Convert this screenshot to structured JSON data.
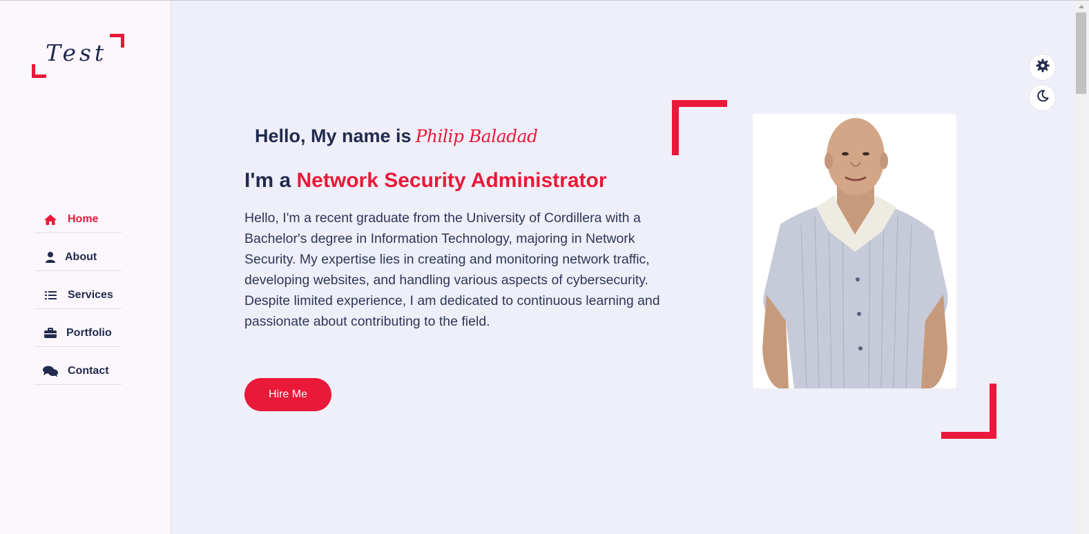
{
  "logo": {
    "text": "Test"
  },
  "nav": {
    "items": [
      {
        "label": "Home",
        "icon": "home-icon",
        "active": true
      },
      {
        "label": "About",
        "icon": "user-icon",
        "active": false
      },
      {
        "label": "Services",
        "icon": "list-icon",
        "active": false
      },
      {
        "label": "Portfolio",
        "icon": "briefcase-icon",
        "active": false
      },
      {
        "label": "Contact",
        "icon": "comments-icon",
        "active": false
      }
    ]
  },
  "hero": {
    "greeting": "Hello, My name is",
    "name": "Philip Baladad",
    "role_prefix": "I'm a",
    "role": "Network Security Administrator",
    "description": "Hello, I'm a recent graduate from the University of Cordillera with a Bachelor's degree in Information Technology, majoring in Network Security. My expertise lies in creating and monitoring network traffic, developing websites, and handling various aspects of cybersecurity. Despite limited experience, I am dedicated to continuous learning and passionate about contributing to the field.",
    "button_label": "Hire Me"
  },
  "controls": {
    "settings_icon": "gear-icon",
    "theme_icon": "moon-icon"
  },
  "colors": {
    "accent": "#ea1839",
    "text": "#222a4e",
    "background": "#eeeff8",
    "sidebar": "#fbf7fd"
  }
}
